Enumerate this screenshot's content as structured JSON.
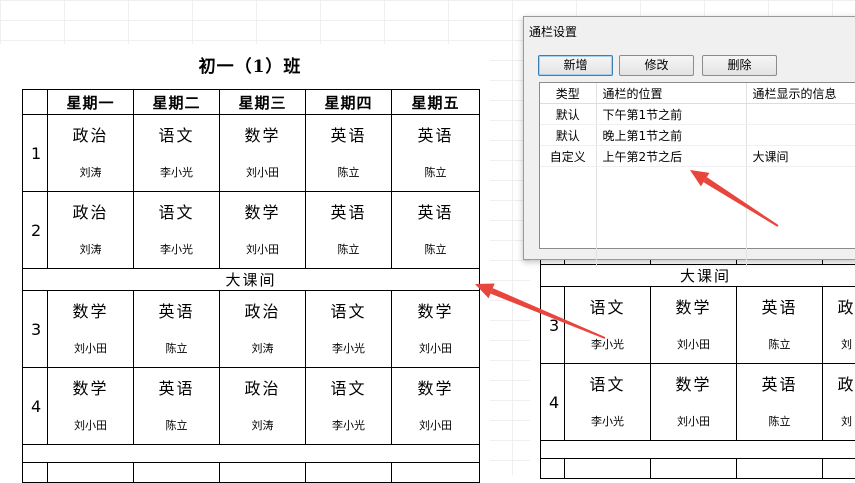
{
  "sheet": {
    "title": "初一（1）班",
    "days": [
      "星期一",
      "星期二",
      "星期三",
      "星期四",
      "星期五"
    ],
    "periods": [
      {
        "num": "1",
        "cells": [
          [
            "政治",
            "刘涛"
          ],
          [
            "语文",
            "李小光"
          ],
          [
            "数学",
            "刘小田"
          ],
          [
            "英语",
            "陈立"
          ],
          [
            "英语",
            "陈立"
          ]
        ]
      },
      {
        "num": "2",
        "cells": [
          [
            "政治",
            "刘涛"
          ],
          [
            "语文",
            "李小光"
          ],
          [
            "数学",
            "刘小田"
          ],
          [
            "英语",
            "陈立"
          ],
          [
            "英语",
            "陈立"
          ]
        ]
      },
      {
        "num": "3",
        "cells": [
          [
            "数学",
            "刘小田"
          ],
          [
            "英语",
            "陈立"
          ],
          [
            "政治",
            "刘涛"
          ],
          [
            "语文",
            "李小光"
          ],
          [
            "数学",
            "刘小田"
          ]
        ]
      },
      {
        "num": "4",
        "cells": [
          [
            "数学",
            "刘小田"
          ],
          [
            "英语",
            "陈立"
          ],
          [
            "政治",
            "刘涛"
          ],
          [
            "语文",
            "李小光"
          ],
          [
            "数学",
            "刘小田"
          ]
        ]
      }
    ],
    "break_label": "大课间"
  },
  "sheet_right": {
    "break_label": "大课间",
    "periods": [
      {
        "num": "3",
        "cells": [
          [
            "语文",
            "李小光"
          ],
          [
            "数学",
            "刘小田"
          ],
          [
            "英语",
            "陈立"
          ],
          [
            "政",
            "刘"
          ]
        ]
      },
      {
        "num": "4",
        "cells": [
          [
            "语文",
            "李小光"
          ],
          [
            "数学",
            "刘小田"
          ],
          [
            "英语",
            "陈立"
          ],
          [
            "政",
            "刘"
          ]
        ]
      }
    ]
  },
  "dialog": {
    "title": "通栏设置",
    "buttons": {
      "new": "新增",
      "edit": "修改",
      "delete": "删除"
    },
    "columns": [
      "类型",
      "通栏的位置",
      "通栏显示的信息"
    ],
    "rows": [
      [
        "默认",
        "下午第1节之前",
        ""
      ],
      [
        "默认",
        "晚上第1节之前",
        ""
      ],
      [
        "自定义",
        "上午第2节之后",
        "大课间"
      ]
    ]
  },
  "annotation_color": "#e8453c"
}
